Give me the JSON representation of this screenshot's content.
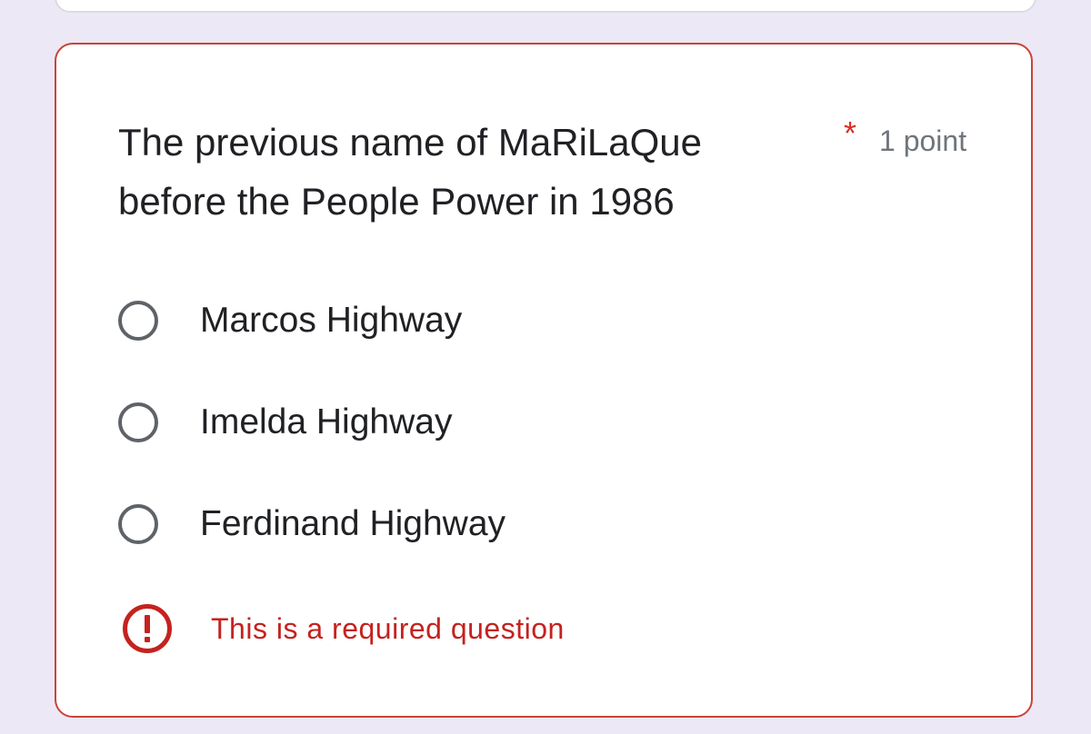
{
  "question": {
    "title": "The previous name of MaRiLaQue before the People Power in 1986",
    "required_marker": "*",
    "points": "1 point",
    "options": [
      {
        "label": "Marcos Highway",
        "selected": false
      },
      {
        "label": "Imelda Highway",
        "selected": false
      },
      {
        "label": "Ferdinand Highway",
        "selected": false
      }
    ],
    "error": {
      "icon": "error-icon",
      "text": "This is a required question"
    }
  },
  "colors": {
    "page_background": "#ede8f5",
    "card_background": "#ffffff",
    "error_border": "#c9433a",
    "error_text": "#c5221f",
    "required_star": "#d93025",
    "radio_border": "#5f6368",
    "text_primary": "#202124",
    "text_secondary": "#70757a"
  }
}
